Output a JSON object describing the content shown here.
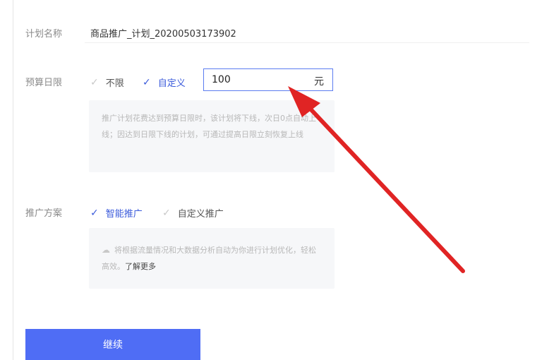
{
  "plan": {
    "label": "计划名称",
    "value": "商品推广_计划_20200503173902"
  },
  "budget": {
    "label": "预算日限",
    "options": [
      {
        "label": "不限",
        "selected": false
      },
      {
        "label": "自定义",
        "selected": true
      }
    ],
    "value": "100",
    "unit": "元",
    "note": "推广计划花费达到预算日限时，该计划将下线，次日0点自动上线；因达到日限下线的计划，可通过提高日限立刻恢复上线"
  },
  "scheme": {
    "label": "推广方案",
    "options": [
      {
        "label": "智能推广",
        "selected": true
      },
      {
        "label": "自定义推广",
        "selected": false
      }
    ],
    "note": "将根据流量情况和大数据分析自动为你进行计划优化，轻松高效。",
    "learn_more": "了解更多"
  },
  "continue_button": "继续",
  "colors": {
    "accent": "#3b5bdb",
    "button": "#4f6df5",
    "arrow": "#e02424"
  }
}
